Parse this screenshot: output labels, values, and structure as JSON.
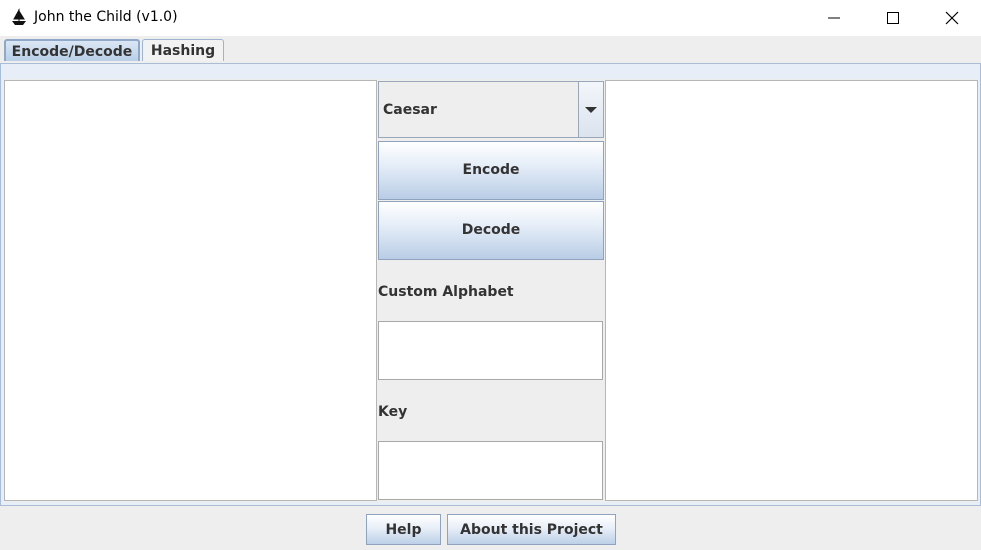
{
  "window": {
    "title": "John the Child (v1.0)",
    "icons": {
      "app": "ship-icon",
      "minimize": "minimize-icon",
      "maximize": "maximize-icon",
      "close": "close-icon"
    }
  },
  "tabs": [
    {
      "label": "Encode/Decode",
      "selected": true
    },
    {
      "label": "Hashing",
      "selected": false
    }
  ],
  "encode_decode": {
    "input_text": "",
    "output_text": "",
    "cipher": {
      "selected": "Caesar",
      "icon": "chevron-down-icon"
    },
    "encode_label": "Encode",
    "decode_label": "Decode",
    "custom_alphabet_label": "Custom Alphabet",
    "custom_alphabet_value": "",
    "key_label": "Key",
    "key_value": ""
  },
  "footer": {
    "help_label": "Help",
    "about_label": "About this Project"
  },
  "colors": {
    "accent": "#b8cfe8",
    "window_bg": "#eeeeee",
    "field_bg": "#ffffff"
  }
}
